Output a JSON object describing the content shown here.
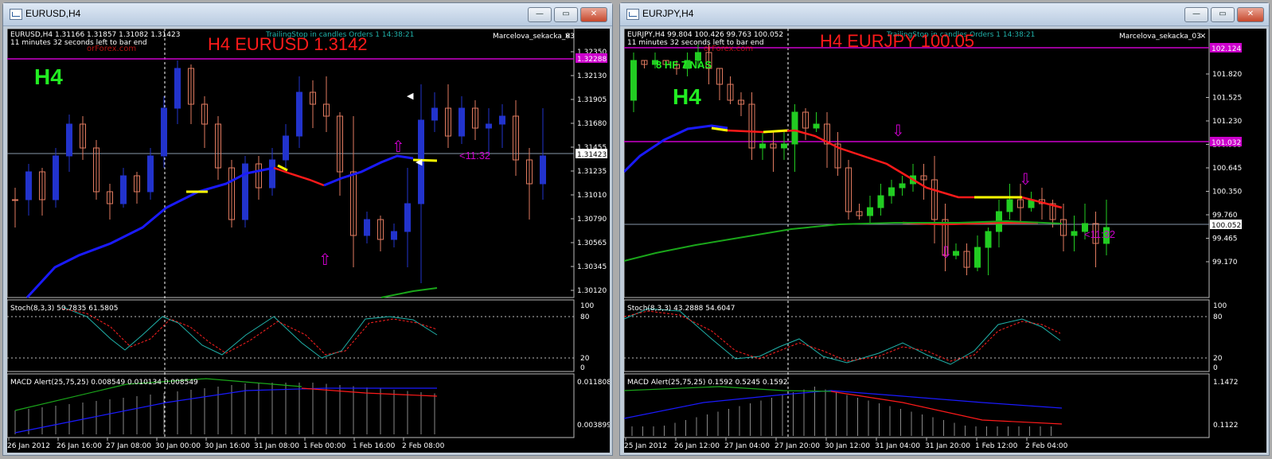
{
  "left": {
    "title": "EURUSD,H4",
    "info": "EURUSD,H4  1.31166 1.31857 1.31082 1.31423",
    "timer": "11 minutes 32 seconds left to bar end",
    "trailing": "TrailingStop  in candles  Orders 1  14:38:21",
    "ea_name": "Marcelova_sekacka_03",
    "big_label": "H4 EURUSD 1.3142",
    "tf_label": "H4",
    "watermark": "orForex.com",
    "countdown": "<11:32",
    "price_ticks": [
      "1.32350",
      "1.32130",
      "1.31905",
      "1.31680",
      "1.31455",
      "1.31235",
      "1.31010",
      "1.30790",
      "1.30565",
      "1.30345",
      "1.30120"
    ],
    "hline_price": "1.32288",
    "current_price": "1.31423",
    "stoch_label": "Stoch(8,3,3) 50.7835 61.5805",
    "stoch_ticks": [
      "100",
      "80",
      "20",
      "0"
    ],
    "macd_label": "MACD Alert(25,75,25) 0.008549 0.010134 0.008549",
    "macd_ticks": [
      "0.011808",
      "0.003899"
    ],
    "time_ticks": [
      "26 Jan 2012",
      "26 Jan 16:00",
      "27 Jan 08:00",
      "30 Jan 00:00",
      "30 Jan 16:00",
      "31 Jan 08:00",
      "1 Feb 00:00",
      "1 Feb 16:00",
      "2 Feb 08:00"
    ]
  },
  "right": {
    "title": "EURJPY,H4",
    "info": "EURJPY,H4  99.804 100.426 99.763 100.052",
    "timer": "11 minutes 32 seconds left to bar end",
    "trailing": "TrailingStop  in candles  Orders 1  14:38:21",
    "ea_name": "Marcelova_sekacka_03",
    "big_label": "H4 EURJPY 100.05",
    "tf_label": "H4",
    "note_label": "8 HF 7 NAS",
    "watermark": "orForex.com",
    "countdown": "<11:32",
    "price_ticks": [
      "101.820",
      "101.525",
      "101.230",
      "100.935",
      "100.645",
      "100.350",
      "99.760",
      "99.465",
      "99.170"
    ],
    "hline_top_price": "102.124",
    "hline_mid_price": "101.032",
    "current_price": "100.052",
    "stoch_label": "Stoch(8,3,3) 43.2888 54.6047",
    "stoch_ticks": [
      "100",
      "80",
      "20",
      "0"
    ],
    "macd_label": "MACD Alert(25,75,25) 0.1592 0.5245 0.1592",
    "macd_ticks": [
      "1.1472",
      "0.1122"
    ],
    "time_ticks": [
      "25 Jan 2012",
      "26 Jan 12:00",
      "27 Jan 04:00",
      "27 Jan 20:00",
      "30 Jan 12:00",
      "31 Jan 04:00",
      "31 Jan 20:00",
      "1 Feb 12:00",
      "2 Feb 04:00"
    ]
  },
  "window_buttons": {
    "minimize": "—",
    "maximize": "▭",
    "close": "✕"
  },
  "colors": {
    "bull_left": "#2233cc",
    "bear": "#e07a5f",
    "bull_right": "#22cc22",
    "ma_blue": "#1a1aff",
    "ma_red": "#ff1a1a",
    "ma_yellow": "#ffff00",
    "ma_green": "#1aa61a",
    "magenta": "#cc00cc",
    "stoch_main": "#20b2aa",
    "stoch_signal": "#ff2020"
  }
}
